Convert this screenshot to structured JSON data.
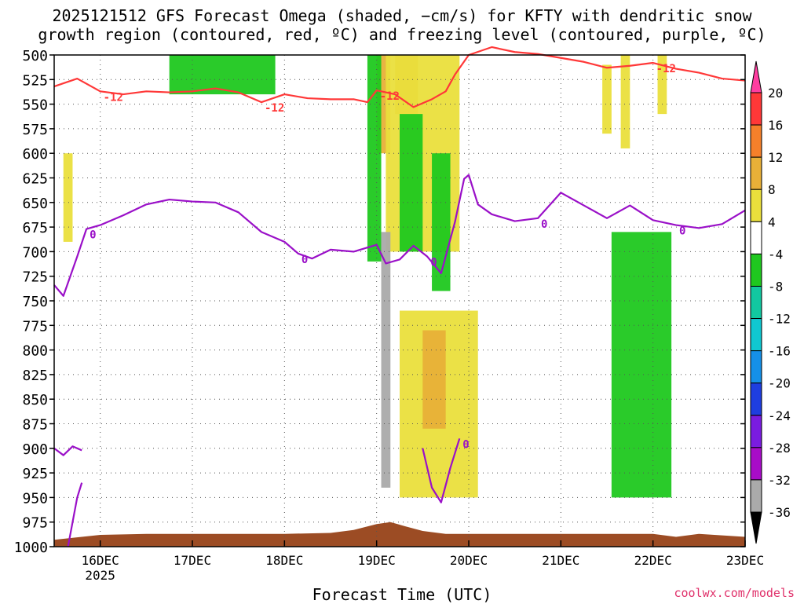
{
  "title": {
    "line1": "2025121512 GFS Forecast Omega (shaded, −cm/s) for KFTY with dendritic snow",
    "line2": "growth region (contoured, red, ºC) and freezing level (contoured, purple, ºC)"
  },
  "xlabel": "Forecast Time (UTC)",
  "credit": "coolwx.com/models",
  "chart_data": {
    "type": "heatmap",
    "title": "2025121512 GFS Forecast Omega (shaded, −cm/s) for KFTY with dendritic snow growth region (contoured, red, ºC) and freezing level (contoured, purple, ºC)",
    "xlabel": "Forecast Time (UTC)",
    "ylabel": "",
    "y_axis": {
      "inverted": true,
      "ylim": [
        1000,
        500
      ],
      "ticks": [
        500,
        525,
        550,
        575,
        600,
        625,
        650,
        675,
        700,
        725,
        750,
        775,
        800,
        825,
        850,
        875,
        900,
        925,
        950,
        975,
        1000
      ]
    },
    "x_axis": {
      "xlim": [
        15.5,
        23.0
      ],
      "ticks": [
        {
          "value": 16,
          "label": "16DEC",
          "sublabel": "2025"
        },
        {
          "value": 17,
          "label": "17DEC"
        },
        {
          "value": 18,
          "label": "18DEC"
        },
        {
          "value": 19,
          "label": "19DEC"
        },
        {
          "value": 20,
          "label": "20DEC"
        },
        {
          "value": 21,
          "label": "21DEC"
        },
        {
          "value": 22,
          "label": "22DEC"
        },
        {
          "value": 23,
          "label": "23DEC"
        }
      ]
    },
    "grid": true,
    "colorbar": {
      "labels": [
        "20",
        "16",
        "12",
        "8",
        "4",
        "-4",
        "-8",
        "-12",
        "-16",
        "-20",
        "-24",
        "-28",
        "-32",
        "-36"
      ],
      "colors": [
        "#ff3da0",
        "#ff3838",
        "#f5802a",
        "#e8b038",
        "#eadf3c",
        "#ffffff",
        "#1fc81f",
        "#12c8a0",
        "#10c8d0",
        "#1590e8",
        "#1e3ee0",
        "#7a1ce0",
        "#a80cc8",
        "#aaaaaa",
        "#000000"
      ]
    },
    "series": [
      {
        "name": "-12",
        "color": "#ff3838",
        "x": [
          15.5,
          15.75,
          16.0,
          16.25,
          16.5,
          16.75,
          17.0,
          17.25,
          17.5,
          17.75,
          18.0,
          18.25,
          18.5,
          18.75,
          18.9,
          19.0,
          19.2,
          19.4,
          19.6,
          19.75,
          19.85,
          20.0,
          20.25,
          20.5,
          20.75,
          21.0,
          21.25,
          21.5,
          21.75,
          22.0,
          22.25,
          22.5,
          22.75,
          23.0
        ],
        "y": [
          532,
          524,
          537,
          540,
          537,
          538,
          537,
          534,
          538,
          548,
          540,
          544,
          545,
          545,
          548,
          536,
          540,
          553,
          545,
          537,
          520,
          500,
          492,
          497,
          499,
          503,
          507,
          513,
          511,
          508,
          514,
          518,
          524,
          526
        ]
      },
      {
        "name": "0",
        "color": "#9a10c8",
        "x": [
          15.5,
          15.6,
          15.75,
          15.85,
          16.0,
          16.25,
          16.5,
          16.75,
          17.0,
          17.25,
          17.5,
          17.75,
          18.0,
          18.15,
          18.3,
          18.5,
          18.75,
          19.0,
          19.1,
          19.25,
          19.4,
          19.55,
          19.7,
          19.85,
          19.95,
          20.0,
          20.1,
          20.25,
          20.5,
          20.75,
          21.0,
          21.25,
          21.5,
          21.75,
          22.0,
          22.25,
          22.5,
          22.75,
          23.0
        ],
        "y": [
          734,
          745,
          705,
          677,
          673,
          663,
          652,
          647,
          649,
          650,
          660,
          680,
          690,
          702,
          707,
          698,
          700,
          693,
          712,
          708,
          694,
          705,
          722,
          670,
          626,
          622,
          652,
          662,
          669,
          666,
          640,
          653,
          666,
          653,
          668,
          673,
          676,
          672,
          658
        ]
      },
      {
        "name": "0",
        "color": "#9a10c8",
        "x": [
          15.5,
          15.6,
          15.7,
          15.8
        ],
        "y": [
          900,
          907,
          898,
          902
        ]
      },
      {
        "name": "0",
        "color": "#9a10c8",
        "x": [
          15.65,
          15.75,
          15.8
        ],
        "y": [
          1000,
          950,
          935
        ]
      },
      {
        "name": "0",
        "color": "#9a10c8",
        "x": [
          19.5,
          19.6,
          19.7,
          19.8,
          19.9
        ],
        "y": [
          900,
          940,
          955,
          920,
          890
        ]
      }
    ],
    "shaded_omega": [
      {
        "value": 8,
        "time": [
          19.0,
          19.15
        ],
        "levels": [
          500,
          600
        ]
      },
      {
        "value": 8,
        "time": [
          19.2,
          19.45
        ],
        "levels": [
          500,
          560
        ]
      },
      {
        "value": 4,
        "time": [
          19.1,
          19.9
        ],
        "levels": [
          500,
          700
        ]
      },
      {
        "value": 4,
        "time": [
          19.25,
          20.1
        ],
        "levels": [
          760,
          950
        ]
      },
      {
        "value": 8,
        "time": [
          19.5,
          19.75
        ],
        "levels": [
          780,
          880
        ]
      },
      {
        "value": 4,
        "time": [
          21.45,
          21.55
        ],
        "levels": [
          510,
          580
        ]
      },
      {
        "value": 4,
        "time": [
          21.65,
          21.75
        ],
        "levels": [
          500,
          595
        ]
      },
      {
        "value": 4,
        "time": [
          22.05,
          22.15
        ],
        "levels": [
          500,
          560
        ]
      },
      {
        "value": 4,
        "time": [
          15.6,
          15.7
        ],
        "levels": [
          600,
          690
        ]
      },
      {
        "value": -4,
        "time": [
          18.9,
          19.05
        ],
        "levels": [
          500,
          710
        ]
      },
      {
        "value": -4,
        "time": [
          19.25,
          19.5
        ],
        "levels": [
          560,
          700
        ]
      },
      {
        "value": -4,
        "time": [
          19.6,
          19.8
        ],
        "levels": [
          600,
          740
        ]
      },
      {
        "value": -4,
        "time": [
          16.75,
          17.9
        ],
        "levels": [
          500,
          540
        ]
      },
      {
        "value": -4,
        "time": [
          21.55,
          22.2
        ],
        "levels": [
          680,
          950
        ]
      },
      {
        "value": -32,
        "time": [
          19.05,
          19.15
        ],
        "levels": [
          680,
          940
        ]
      }
    ],
    "terrain": {
      "color": "#9c4c24",
      "x": [
        15.5,
        16.0,
        16.5,
        17.0,
        17.5,
        18.0,
        18.5,
        18.75,
        19.0,
        19.15,
        19.3,
        19.5,
        19.75,
        20.0,
        20.5,
        21.0,
        21.5,
        22.0,
        22.25,
        22.5,
        23.0
      ],
      "y": [
        993,
        988,
        987,
        987,
        987,
        987,
        986,
        983,
        977,
        975,
        979,
        984,
        987,
        987,
        987,
        987,
        987,
        987,
        990,
        987,
        990
      ]
    }
  }
}
